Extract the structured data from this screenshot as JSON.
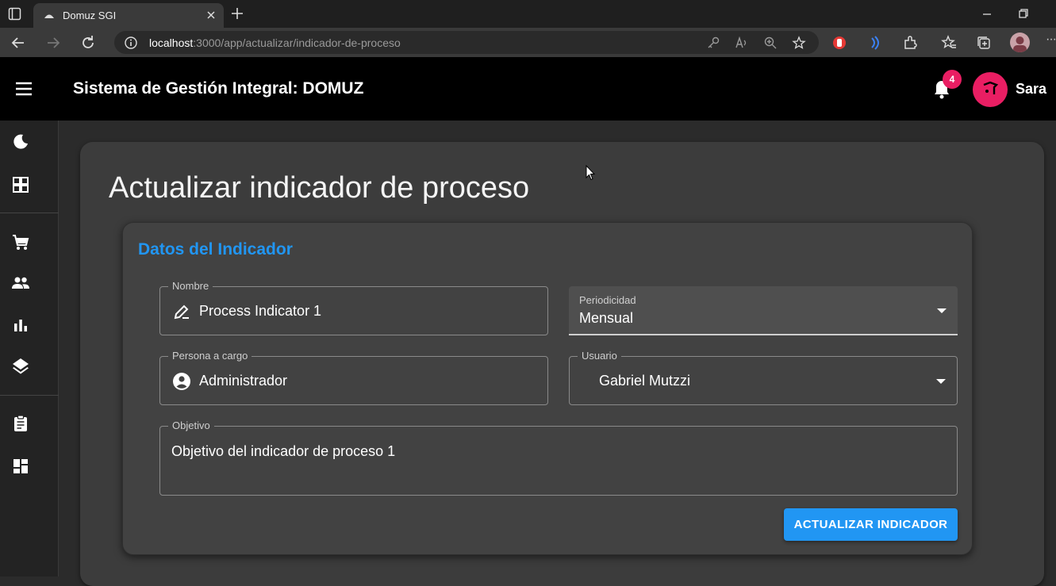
{
  "browser": {
    "tab_title": "Domuz SGI",
    "url_host": "localhost",
    "url_rest": ":3000/app/actualizar/indicador-de-proceso",
    "more": "···"
  },
  "appbar": {
    "title": "Sistema de Gestión Integral: DOMUZ",
    "notification_count": "4",
    "user_name": "Sara"
  },
  "sidebar": {
    "items": [
      "moon-icon",
      "apps-icon",
      "cart-icon",
      "people-icon",
      "bar-chart-icon",
      "layers-icon",
      "clipboard-icon",
      "dashboard-icon"
    ]
  },
  "page": {
    "title": "Actualizar indicador de proceso",
    "section_title": "Datos del Indicador",
    "form": {
      "nombre": {
        "label": "Nombre",
        "value": "Process Indicator 1"
      },
      "periodicidad": {
        "label": "Periodicidad",
        "value": "Mensual"
      },
      "persona": {
        "label": "Persona a cargo",
        "value": "Administrador"
      },
      "usuario": {
        "label": "Usuario",
        "value": "Gabriel Mutzzi"
      },
      "objetivo": {
        "label": "Objetivo",
        "value": "Objetivo del indicador de proceso 1"
      }
    },
    "submit_label": "ACTUALIZAR INDICADOR"
  },
  "colors": {
    "accent": "#2196f3",
    "badge": "#e91e63",
    "appbar": "#000000"
  }
}
